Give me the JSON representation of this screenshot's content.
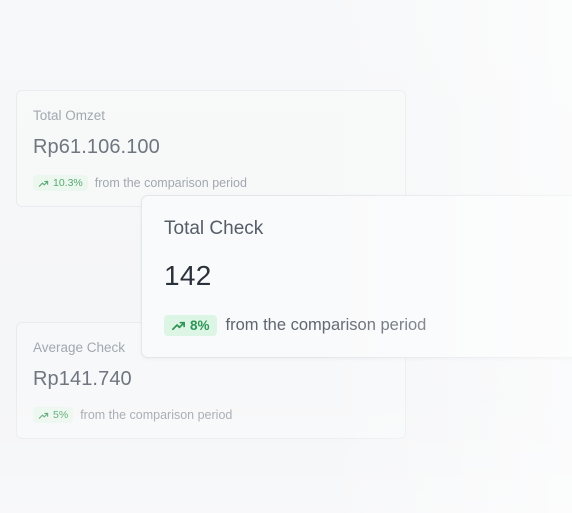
{
  "cards": {
    "total_omzet": {
      "label": "Total Omzet",
      "value": "Rp61.106.100",
      "change": "10.3%",
      "change_note": "from the comparison period"
    },
    "total_check": {
      "label": "Total Check",
      "value": "142",
      "change": "8%",
      "change_note": "from the comparison period"
    },
    "average_check": {
      "label": "Average Check",
      "value": "Rp141.740",
      "change": "5%",
      "change_note": "from the comparison period"
    }
  },
  "icons": {
    "trend": "trending-up-icon"
  },
  "colors": {
    "positive_badge_bg": "#dcf5e4",
    "positive_badge_text": "#2f9455"
  }
}
